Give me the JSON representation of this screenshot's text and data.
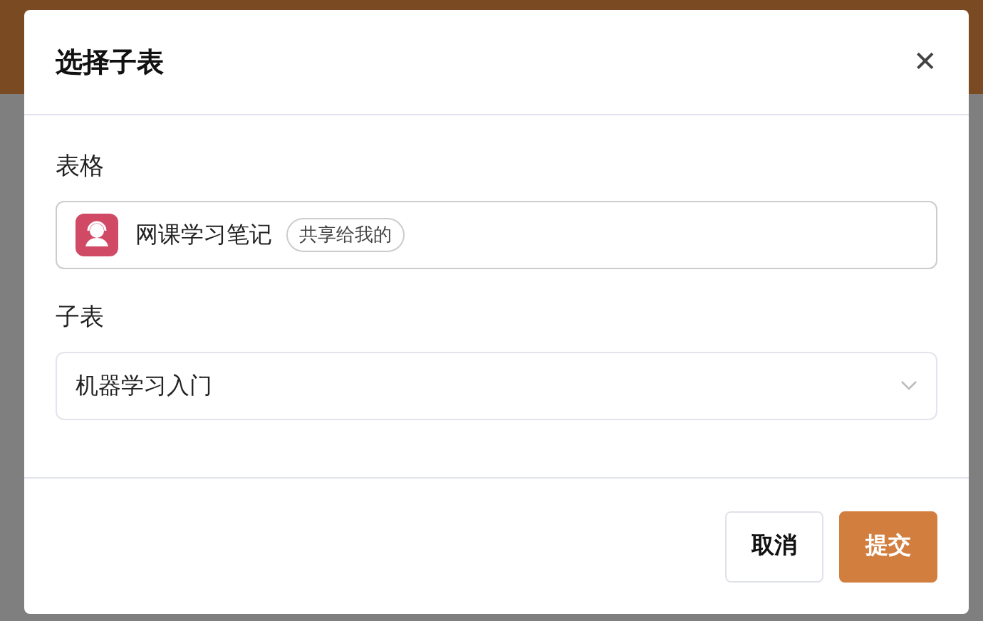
{
  "dialog": {
    "title": "选择子表",
    "close": "✕",
    "table_field": {
      "label": "表格",
      "value": "网课学习笔记",
      "tag": "共享给我的"
    },
    "subtable_field": {
      "label": "子表",
      "value": "机器学习入门"
    },
    "buttons": [
      {
        "label": "取消",
        "kind": "secondary"
      },
      {
        "label": "提交",
        "kind": "primary"
      }
    ]
  }
}
